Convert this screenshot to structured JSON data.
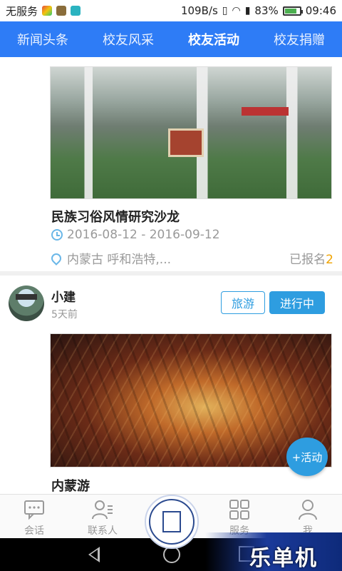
{
  "status_bar": {
    "carrier": "无服务",
    "speed": "109B/s",
    "battery": "83%",
    "battery_level": 0.83,
    "time": "09:46"
  },
  "top_tabs": [
    {
      "label": "新闻头条",
      "active": false
    },
    {
      "label": "校友风采",
      "active": false
    },
    {
      "label": "校友活动",
      "active": true
    },
    {
      "label": "校友捐赠",
      "active": false
    }
  ],
  "activity1": {
    "title": "民族习俗风情研究沙龙",
    "date_range": "2016-08-12 - 2016-09-12",
    "location": "内蒙古 呼和浩特,...",
    "registered_label": "已报名",
    "registered_count": "2"
  },
  "activity2": {
    "user_name": "小建",
    "posted_time": "5天前",
    "category_tag": "旅游",
    "status_tag": "进行中",
    "title": "内蒙游"
  },
  "fab": {
    "label": "+活动"
  },
  "bottom_nav": [
    {
      "label": "会话",
      "icon": "chat-icon"
    },
    {
      "label": "联系人",
      "icon": "contacts-icon"
    },
    {
      "label": "服务",
      "icon": "grid-icon"
    },
    {
      "label": "我",
      "icon": "person-icon"
    }
  ],
  "watermark": "乐单机"
}
